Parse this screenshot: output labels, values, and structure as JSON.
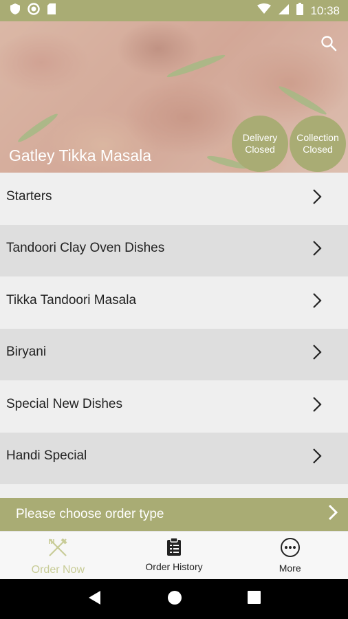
{
  "status_bar": {
    "time": "10:38",
    "left_icons": [
      "shield-icon",
      "circle-record-icon",
      "sd-card-icon"
    ],
    "right_icons": [
      "wifi-icon",
      "signal-icon",
      "battery-icon"
    ],
    "color": "#a9ac74"
  },
  "hero": {
    "title": "Gatley Tikka Masala",
    "delivery_line1": "Delivery",
    "delivery_line2": "Closed",
    "collection_line1": "Collection",
    "collection_line2": "Closed"
  },
  "menu": {
    "items": [
      {
        "label": "Starters"
      },
      {
        "label": "Tandoori Clay Oven Dishes"
      },
      {
        "label": "Tikka Tandoori Masala"
      },
      {
        "label": "Biryani"
      },
      {
        "label": "Special New Dishes"
      },
      {
        "label": "Handi Special"
      }
    ]
  },
  "order_type": {
    "label": "Please choose order type"
  },
  "bottom_nav": {
    "order_now": "Order Now",
    "order_history": "Order History",
    "more": "More"
  },
  "colors": {
    "accent": "#a9ac74",
    "accent_light": "#c8cc97"
  }
}
